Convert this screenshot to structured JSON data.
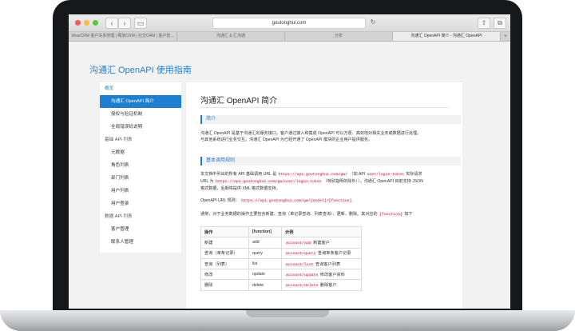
{
  "browser": {
    "url": "goutonghui.com",
    "tabs": [
      {
        "label": "WiseCRM 客户关系管理 | 释放CRM | 社交CRM | 客户管...",
        "active": false
      },
      {
        "label": "沟通汇 & 汇沟通",
        "active": false
      },
      {
        "label": "分析",
        "active": false
      },
      {
        "label": "沟通汇 OpenAPI 简介 - 沟通汇 OpenAPI",
        "active": true
      }
    ],
    "colors": {
      "close": "#ee5d56",
      "minimize": "#f5bd3c",
      "maximize": "#5cc445",
      "accent": "#1e7fd0"
    }
  },
  "site": {
    "title": "沟通汇 OpenAPI 使用指南"
  },
  "sidebar": {
    "items": [
      {
        "label": "概览",
        "type": "first"
      },
      {
        "label": "沟通汇 OpenAPI 简介",
        "type": "item",
        "active": true
      },
      {
        "label": "授权与验证机制",
        "type": "item"
      },
      {
        "label": "全局错误码说明",
        "type": "item"
      },
      {
        "label": "基础 API 列表",
        "type": "group"
      },
      {
        "label": "元数据",
        "type": "item"
      },
      {
        "label": "角色列表",
        "type": "item"
      },
      {
        "label": "部门列表",
        "type": "item"
      },
      {
        "label": "用户列表",
        "type": "item"
      },
      {
        "label": "用户登录",
        "type": "item"
      },
      {
        "label": "数据 API 列表",
        "type": "group"
      },
      {
        "label": "客户管理",
        "type": "item"
      },
      {
        "label": "联系人管理",
        "type": "item"
      }
    ]
  },
  "content": {
    "title": "沟通汇 OpenAPI 简介",
    "intro": {
      "heading": "简介",
      "line1": "沟通汇 OpenAPI 是基于沟通汇的服务接口。客户通过接入和集成 OpenAPI 可以方便、高效地对相关业务或数据进行处理。",
      "line2": "与其他系统进行业务交互。沟通汇 OpenAPI 为已经开通了 OpenAPI 模块的企业用户提供服务。"
    },
    "rules": {
      "heading": "基本调用规则",
      "p1a": "本文档中列出的所有 API 基础调用 URL 是",
      "p1code1": "https://api.goutonghui.com/gw/",
      "p1b": "（如 API",
      "p1code2": "user/login-token",
      "p1c": "实际请求",
      "p2a": "URL 为",
      "p2code": "https://api.goutonghui.com/gw/user/login-token",
      "p2b": "（特别指明的除外））。沟通汇 OpenAPI 目前支持 JSON",
      "p3": "格式数据，后期将提供 XML 格式数据支持。",
      "p4a": "OpenAPI URL 规则：",
      "p4code": "https://api.goutonghui.com/gw/[model]/[function]",
      "p5a": "通常，对于业务数据的操作主要包含新建、查询（单记录查询、列表查询）、更新、删除。其对应的",
      "p5code": "[function]",
      "p5b": "如下"
    },
    "table": {
      "headers": [
        "操作",
        "[function]",
        "示例"
      ],
      "rows": [
        {
          "op": "新建",
          "fn": "add",
          "code": "account/add",
          "desc": "新建客户"
        },
        {
          "op": "查询（单条记录）",
          "fn": "query",
          "code": "account/query",
          "desc": "查询单条客户记录"
        },
        {
          "op": "查询（列表）",
          "fn": "list",
          "code": "account/list",
          "desc": "查询客户列表"
        },
        {
          "op": "修改",
          "fn": "update",
          "code": "account/update",
          "desc": "修改客户资料"
        },
        {
          "op": "删除",
          "fn": "delete",
          "code": "account/delete",
          "desc": "删除客户"
        }
      ]
    }
  }
}
